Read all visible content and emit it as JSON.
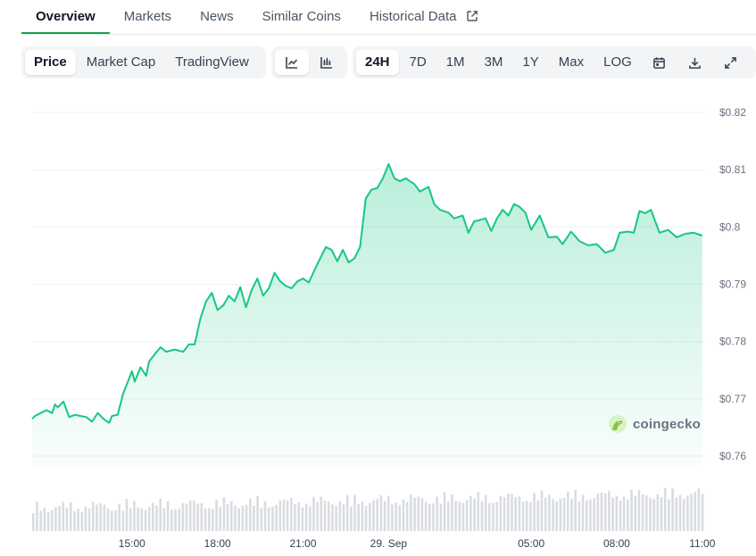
{
  "tabs": [
    {
      "label": "Overview",
      "active": true
    },
    {
      "label": "Markets"
    },
    {
      "label": "News"
    },
    {
      "label": "Similar Coins"
    },
    {
      "label": "Historical Data",
      "icon": "external-link-icon"
    }
  ],
  "toolbar": {
    "chart_kind": [
      "Price",
      "Market Cap",
      "TradingView"
    ],
    "chart_kind_selected": "Price",
    "chart_style_icons": [
      "line-chart-icon",
      "candlestick-chart-icon"
    ],
    "ranges": [
      "24H",
      "7D",
      "1M",
      "3M",
      "1Y",
      "Max",
      "LOG"
    ],
    "range_selected": "24H",
    "action_icons": [
      "calendar-icon",
      "download-icon",
      "fullscreen-icon"
    ]
  },
  "watermark": {
    "text": "coingecko",
    "icon": "gecko-logo-icon"
  },
  "colors": {
    "line": "#16c784",
    "accent": "#16a34a",
    "grid": "#eef0f3",
    "volume": "#d9dce1"
  },
  "chart_data": {
    "type": "area",
    "y_tick_labels": [
      "$0.82",
      "$0.81",
      "$0.8",
      "$0.79",
      "$0.78",
      "$0.77",
      "$0.76"
    ],
    "y_ticks": [
      0.82,
      0.81,
      0.8,
      0.79,
      0.78,
      0.77,
      0.76
    ],
    "ylim": [
      0.7575,
      0.8225
    ],
    "x_tick_labels": [
      "15:00",
      "18:00",
      "21:00",
      "29. Sep",
      "05:00",
      "08:00",
      "11:00"
    ],
    "x_ticks": [
      15,
      18,
      21,
      24,
      29,
      32,
      35
    ],
    "xlim": [
      11.5,
      35.1
    ],
    "grid": true,
    "series": [
      {
        "x": [
          11.5,
          11.6,
          11.8,
          12.0,
          12.2,
          12.3,
          12.4,
          12.6,
          12.8,
          13.0,
          13.2,
          13.4,
          13.6,
          13.8,
          14.0,
          14.2,
          14.3,
          14.5,
          14.7,
          14.9,
          15.0,
          15.1,
          15.3,
          15.5,
          15.6,
          15.8,
          16.0,
          16.2,
          16.5,
          16.8,
          17.0,
          17.2,
          17.4,
          17.6,
          17.8,
          18.0,
          18.2,
          18.4,
          18.6,
          18.8,
          19.0,
          19.2,
          19.4,
          19.6,
          19.8,
          20.0,
          20.2,
          20.4,
          20.6,
          20.8,
          21.0,
          21.2,
          21.5,
          21.8,
          22.0,
          22.2,
          22.4,
          22.6,
          22.8,
          23.0,
          23.2,
          23.4,
          23.6,
          23.8,
          24.0,
          24.2,
          24.4,
          24.6,
          24.9,
          25.1,
          25.4,
          25.6,
          25.8,
          26.1,
          26.3,
          26.6,
          26.8,
          27.0,
          27.2,
          27.4,
          27.6,
          27.8,
          28.0,
          28.2,
          28.4,
          28.6,
          28.8,
          29.0,
          29.3,
          29.6,
          29.9,
          30.1,
          30.4,
          30.7,
          31.0,
          31.3,
          31.6,
          31.9,
          32.1,
          32.4,
          32.6,
          32.8,
          33.0,
          33.2,
          33.5,
          33.8,
          34.1,
          34.4,
          34.7,
          35.0
        ],
        "values": [
          0.7665,
          0.767,
          0.7675,
          0.768,
          0.7675,
          0.769,
          0.7685,
          0.7695,
          0.7668,
          0.7672,
          0.767,
          0.7668,
          0.766,
          0.7675,
          0.7665,
          0.7658,
          0.767,
          0.7672,
          0.771,
          0.7735,
          0.7748,
          0.773,
          0.7755,
          0.774,
          0.7765,
          0.7778,
          0.779,
          0.7782,
          0.7786,
          0.7782,
          0.7795,
          0.7795,
          0.784,
          0.787,
          0.7885,
          0.7855,
          0.7863,
          0.788,
          0.787,
          0.7895,
          0.786,
          0.789,
          0.791,
          0.788,
          0.7893,
          0.792,
          0.7905,
          0.7897,
          0.7893,
          0.7905,
          0.791,
          0.7903,
          0.7935,
          0.7965,
          0.796,
          0.794,
          0.796,
          0.7938,
          0.7945,
          0.7965,
          0.805,
          0.8065,
          0.8068,
          0.8085,
          0.811,
          0.8085,
          0.808,
          0.8085,
          0.8075,
          0.8062,
          0.807,
          0.804,
          0.803,
          0.8025,
          0.8015,
          0.802,
          0.799,
          0.801,
          0.8012,
          0.8015,
          0.7993,
          0.8015,
          0.803,
          0.802,
          0.804,
          0.8035,
          0.8025,
          0.7995,
          0.802,
          0.7982,
          0.7983,
          0.797,
          0.7992,
          0.7975,
          0.7968,
          0.797,
          0.7955,
          0.796,
          0.799,
          0.7992,
          0.799,
          0.8028,
          0.8024,
          0.803,
          0.799,
          0.7995,
          0.7982,
          0.7988,
          0.799,
          0.7985
        ]
      }
    ]
  }
}
